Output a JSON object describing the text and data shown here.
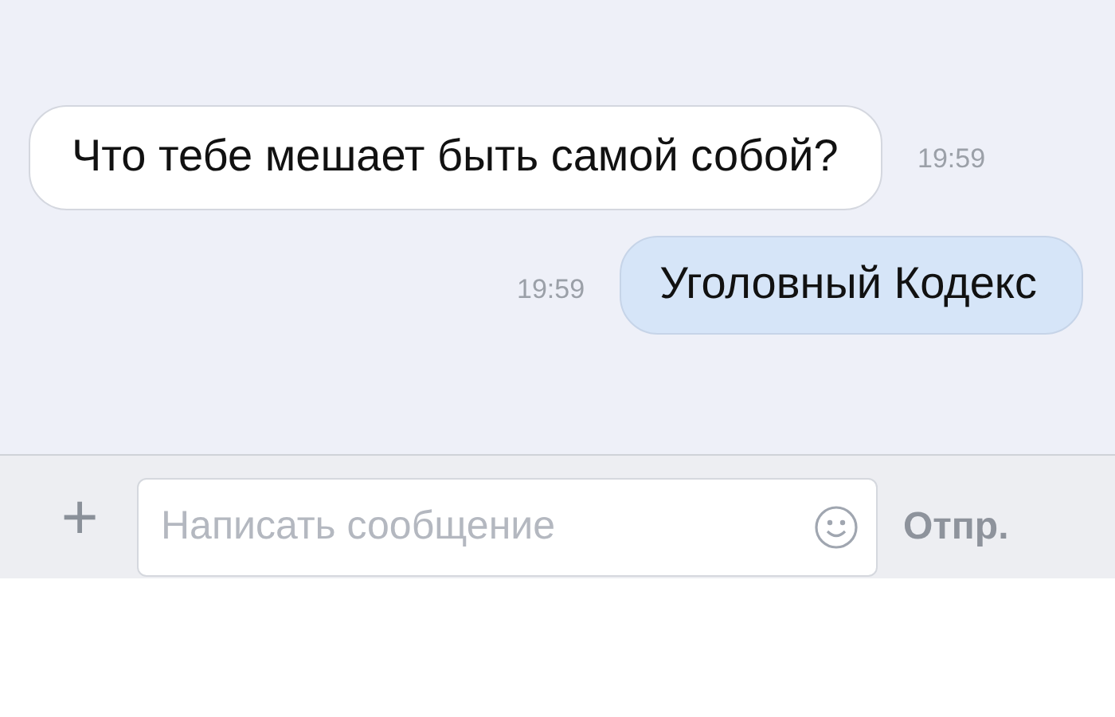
{
  "messages": [
    {
      "kind": "incoming",
      "text": "Что тебе мешает быть самой собой?",
      "time": "19:59"
    },
    {
      "kind": "outgoing",
      "text": "Уголовный Кодекс",
      "time": "19:59"
    }
  ],
  "composer": {
    "attach": "+",
    "placeholder": "Написать сообщение",
    "send": "Отпр."
  }
}
